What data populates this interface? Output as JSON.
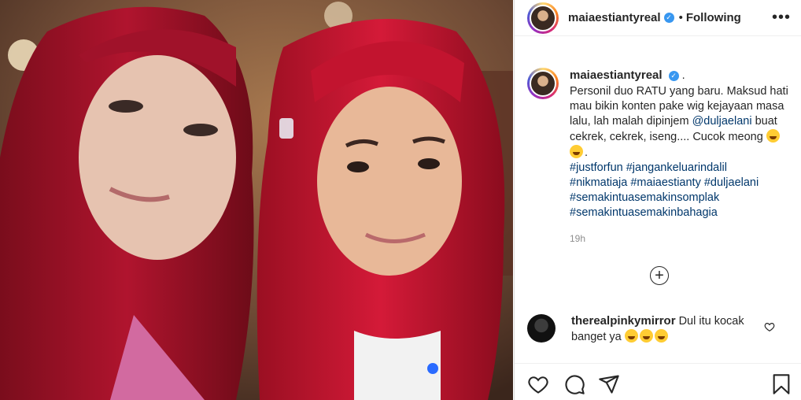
{
  "post": {
    "author": "maiaestiantyreal",
    "follow_dot": "•",
    "follow_status": "Following",
    "more_label": "•••"
  },
  "caption": {
    "username": "maiaestiantyreal",
    "period": ".",
    "text_1": "Personil duo RATU yang baru. Maksud hati mau bikin konten pake wig kejayaan masa lalu, lah malah dipinjem ",
    "mention": "@duljaelani",
    "text_2": " buat cekrek, cekrek, iseng.... Cucok meong ",
    "text_3": ".",
    "hashtags": [
      "#justforfun #jangankeluarindalil",
      "#nikmatiaja #maiaestianty #duljaelani",
      "#semakintuasemakinsomplak",
      "#semakintuasemakinbahagia"
    ],
    "time": "19h"
  },
  "comment": {
    "username": "therealpinkymirror",
    "text": " Dul itu kocak banget ya "
  },
  "icons": {
    "verified": "verified-badge-icon",
    "add": "add-comment-circle-icon",
    "like": "heart-icon",
    "comment": "comment-icon",
    "share": "paper-plane-icon",
    "save": "bookmark-icon"
  },
  "colors": {
    "link": "#00376b",
    "verified": "#3897f0",
    "text": "#262626",
    "muted": "#8e8e8e",
    "wig": "#c8102e"
  }
}
